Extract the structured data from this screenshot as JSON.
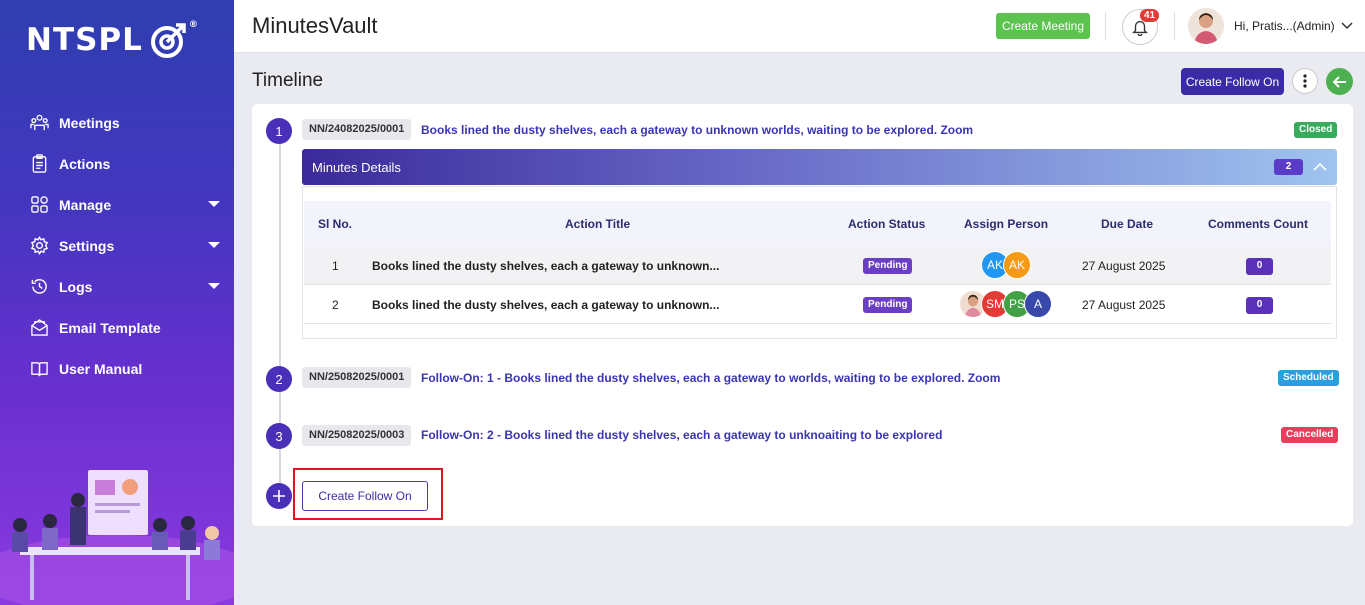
{
  "brand": {
    "logo_text": "NTSPL",
    "logo_reg": "®"
  },
  "sidebar": {
    "items": [
      {
        "label": "Meetings",
        "icon": "meetings-icon",
        "has_caret": false
      },
      {
        "label": "Actions",
        "icon": "clipboard-icon",
        "has_caret": false
      },
      {
        "label": "Manage",
        "icon": "grid-icon",
        "has_caret": true
      },
      {
        "label": "Settings",
        "icon": "gear-icon",
        "has_caret": true
      },
      {
        "label": "Logs",
        "icon": "history-icon",
        "has_caret": true
      },
      {
        "label": "Email Template",
        "icon": "envelope-icon",
        "has_caret": false
      },
      {
        "label": "User Manual",
        "icon": "book-icon",
        "has_caret": false
      }
    ]
  },
  "header": {
    "app_title": "MinutesVault",
    "create_meeting_label": "Create Meeting",
    "notification_count": "41",
    "user_greeting": "Hi, Pratis...(Admin)"
  },
  "page": {
    "title": "Timeline",
    "create_follow_on_label": "Create Follow On"
  },
  "timeline": [
    {
      "step": "1",
      "code": "NN/24082025/0001",
      "title": "Books lined the dusty shelves, each a gateway to unknown worlds, waiting to be explored. Zoom",
      "status": "Closed",
      "status_color": "#3aaa5c"
    },
    {
      "step": "2",
      "code": "NN/25082025/0001",
      "title": "Follow-On: 1 - Books lined the dusty shelves, each a gateway to worlds, waiting to be explored. Zoom",
      "status": "Scheduled",
      "status_color": "#2a9fe0"
    },
    {
      "step": "3",
      "code": "NN/25082025/0003",
      "title": "Follow-On: 2 - Books lined the dusty shelves, each a gateway to unknoaiting to be explored",
      "status": "Cancelled",
      "status_color": "#e83e5b"
    }
  ],
  "minutes": {
    "label": "Minutes Details",
    "count": "2",
    "columns": [
      "Sl No.",
      "Action Title",
      "Action Status",
      "Assign Person",
      "Due Date",
      "Comments Count"
    ],
    "rows": [
      {
        "sl": "1",
        "title": "Books lined the dusty shelves, each a gateway to unknown...",
        "status": "Pending",
        "assignees": [
          {
            "initials": "AK",
            "color": "#2196f3"
          },
          {
            "initials": "AK",
            "color": "#f59a14"
          }
        ],
        "due": "27 August 2025",
        "comments": "0"
      },
      {
        "sl": "2",
        "title": "Books lined the dusty shelves, each a gateway to unknown...",
        "status": "Pending",
        "assignees": [
          {
            "initials": "",
            "color": "#f1dcd0",
            "photo": true
          },
          {
            "initials": "SM",
            "color": "#e53935"
          },
          {
            "initials": "PS",
            "color": "#43a047"
          },
          {
            "initials": "A",
            "color": "#3949ab"
          }
        ],
        "due": "27 August 2025",
        "comments": "0"
      }
    ]
  },
  "footer_action": {
    "create_follow_on_label": "Create Follow On"
  },
  "colors": {
    "primary": "#3b2ba8",
    "accent_green": "#5cc44e",
    "highlight_red": "#e0161e"
  }
}
